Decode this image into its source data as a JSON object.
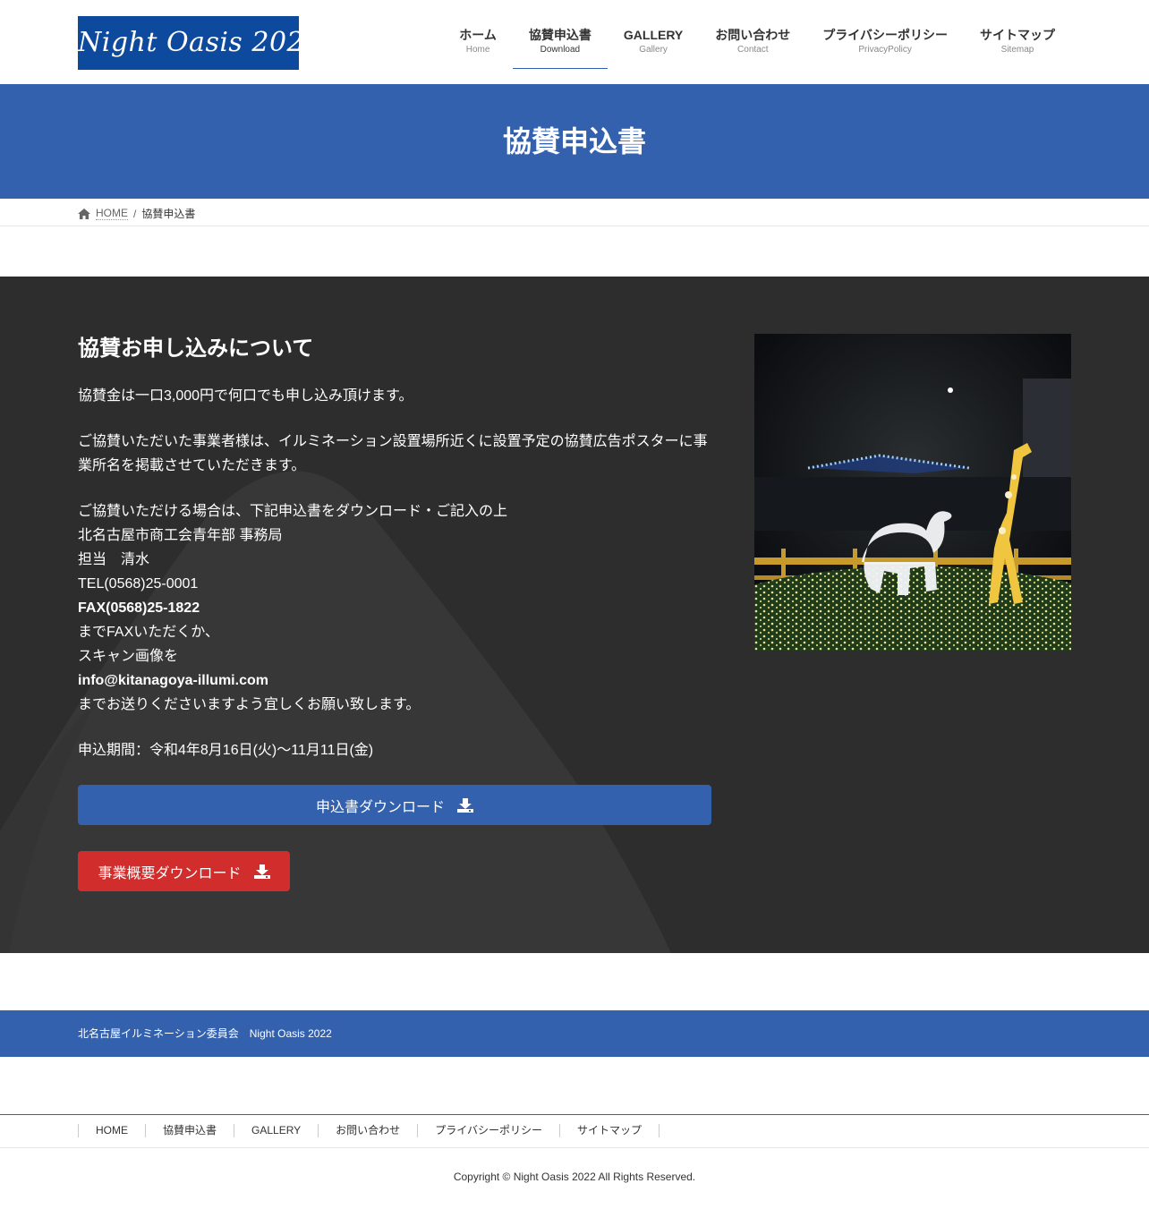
{
  "header": {
    "logo_text": "Night Oasis 2022",
    "nav": [
      {
        "label": "ホーム",
        "sub": "Home"
      },
      {
        "label": "協賛申込書",
        "sub": "Download"
      },
      {
        "label": "GALLERY",
        "sub": "Gallery"
      },
      {
        "label": "お問い合わせ",
        "sub": "Contact"
      },
      {
        "label": "プライバシーポリシー",
        "sub": "PrivacyPolicy"
      },
      {
        "label": "サイトマップ",
        "sub": "Sitemap"
      }
    ]
  },
  "page_title": "協賛申込書",
  "breadcrumb": {
    "home": "HOME",
    "separator": "/",
    "current": "協賛申込書"
  },
  "main": {
    "heading": "協賛お申し込みについて",
    "p1": "協賛金は一口3,000円で何口でも申し込み頂けます。",
    "p2": "ご協賛いただいた事業者様は、イルミネーション設置場所近くに設置予定の協賛広告ポスターに事業所名を掲載させていただきます。",
    "p3_lines": [
      "ご協賛いただける場合は、下記申込書をダウンロード・ご記入の上",
      "北名古屋市商工会青年部 事務局",
      "担当　清水",
      "TEL(0568)25-0001",
      "FAX(0568)25-1822",
      "までFAXいただくか、",
      "スキャン画像を",
      "info@kitanagoya-illumi.com",
      "までお送りくださいますよう宜しくお願い致します。"
    ],
    "period": "申込期間：令和4年8月16日(火)～11月11日(金)",
    "btn_application": "申込書ダウンロード",
    "btn_overview": "事業概要ダウンロード"
  },
  "footer": {
    "band_text": "北名古屋イルミネーション委員会　Night Oasis 2022",
    "nav": [
      "HOME",
      "協賛申込書",
      "GALLERY",
      "お問い合わせ",
      "プライバシーポリシー",
      "サイトマップ"
    ],
    "copyright": "Copyright © Night Oasis 2022 All Rights Reserved."
  },
  "colors": {
    "primary": "#3361ae",
    "dark_bg": "#2d2d2d",
    "danger": "#d12d2d"
  }
}
